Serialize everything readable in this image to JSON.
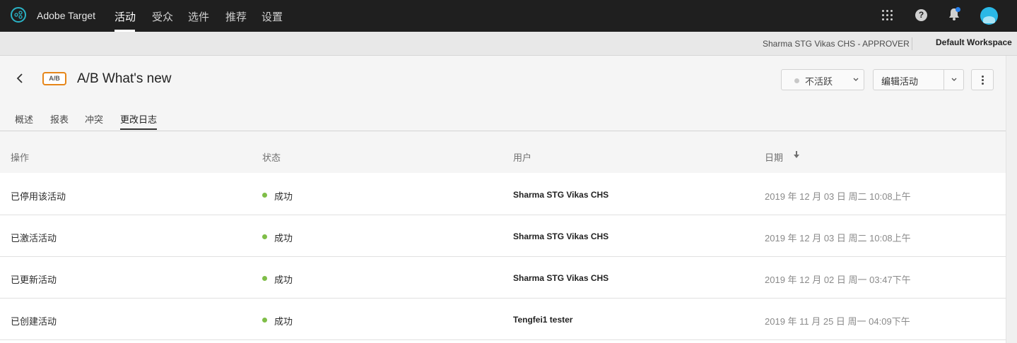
{
  "app": {
    "name": "Adobe Target"
  },
  "topnav": {
    "items": [
      {
        "label": "活动",
        "active": true
      },
      {
        "label": "受众",
        "active": false
      },
      {
        "label": "选件",
        "active": false
      },
      {
        "label": "推荐",
        "active": false
      },
      {
        "label": "设置",
        "active": false
      }
    ],
    "icons": [
      "apps-icon",
      "help-icon",
      "bell-icon",
      "avatar"
    ],
    "help_glyph": "?"
  },
  "workspace": {
    "user": "Sharma STG Vikas CHS - APPROVER",
    "name": "Default Workspace"
  },
  "activity": {
    "badge": "A/B",
    "title": "A/B What's new",
    "status": "不活跃",
    "edit_label": "编辑活动"
  },
  "tabs": [
    {
      "label": "概述",
      "active": false
    },
    {
      "label": "报表",
      "active": false
    },
    {
      "label": "冲突",
      "active": false
    },
    {
      "label": "更改日志",
      "active": true
    }
  ],
  "table": {
    "columns": [
      "操作",
      "状态",
      "用户",
      "日期"
    ],
    "sort_column": "日期",
    "sort_direction": "descending",
    "rows": [
      {
        "action": "已停用该活动",
        "status": "成功",
        "user": "Sharma STG Vikas CHS",
        "date": "2019 年 12 月 03 日 周二 10:08上午"
      },
      {
        "action": "已激活活动",
        "status": "成功",
        "user": "Sharma STG Vikas CHS",
        "date": "2019 年 12 月 03 日 周二 10:08上午"
      },
      {
        "action": "已更新活动",
        "status": "成功",
        "user": "Sharma STG Vikas CHS",
        "date": "2019 年 12 月 02 日 周一 03:47下午"
      },
      {
        "action": "已创建活动",
        "status": "成功",
        "user": "Tengfei1 tester",
        "date": "2019 年 11 月 25 日 周一 04:09下午"
      }
    ]
  },
  "colors": {
    "topnav_bg": "#1f1f1f",
    "brand_accent": "#2ab3c6",
    "badge_border": "#e68619",
    "success": "#7fbe48",
    "notification": "#2680eb"
  }
}
